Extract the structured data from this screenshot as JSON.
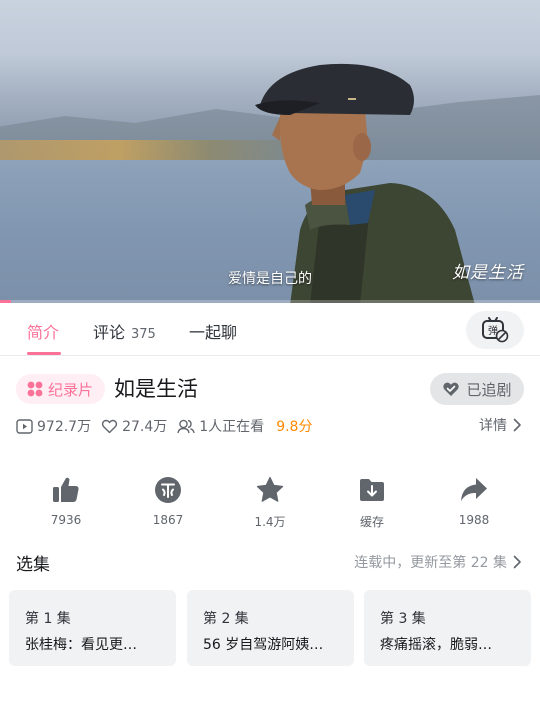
{
  "player": {
    "subtitle": "爱情是自己的",
    "watermark": "如是生活",
    "progress_fraction": 0.02
  },
  "tabs": [
    {
      "label": "简介",
      "active": true
    },
    {
      "label": "评论",
      "count": "375",
      "active": false
    },
    {
      "label": "一起聊",
      "active": false
    }
  ],
  "danmaku": {
    "icon": "danmaku-off-icon",
    "glyph": "弹"
  },
  "show": {
    "badge": "纪录片",
    "title": "如是生活",
    "follow_label": "已追剧"
  },
  "stats": {
    "plays": "972.7万",
    "likes": "27.4万",
    "watching": "1人正在看",
    "score": "9.8分",
    "details_label": "详情"
  },
  "actions": [
    {
      "name": "like",
      "icon": "thumbs-up-icon",
      "label": "7936"
    },
    {
      "name": "coin",
      "icon": "coin-icon",
      "label": "1867"
    },
    {
      "name": "favorite",
      "icon": "star-icon",
      "label": "1.4万"
    },
    {
      "name": "cache",
      "icon": "download-icon",
      "label": "缓存"
    },
    {
      "name": "share",
      "icon": "share-icon",
      "label": "1988"
    }
  ],
  "episodes_section": {
    "title": "选集",
    "status": "连载中，更新至第 22 集"
  },
  "episodes": [
    {
      "num": "第 1 集",
      "title": "张桂梅：看见更…"
    },
    {
      "num": "第 2 集",
      "title": "56 岁自驾游阿姨…"
    },
    {
      "num": "第 3 集",
      "title": "疼痛摇滚，脆弱…"
    }
  ],
  "colors": {
    "accent": "#fb7299",
    "score": "#ff8a00",
    "muted": "#61666d"
  }
}
